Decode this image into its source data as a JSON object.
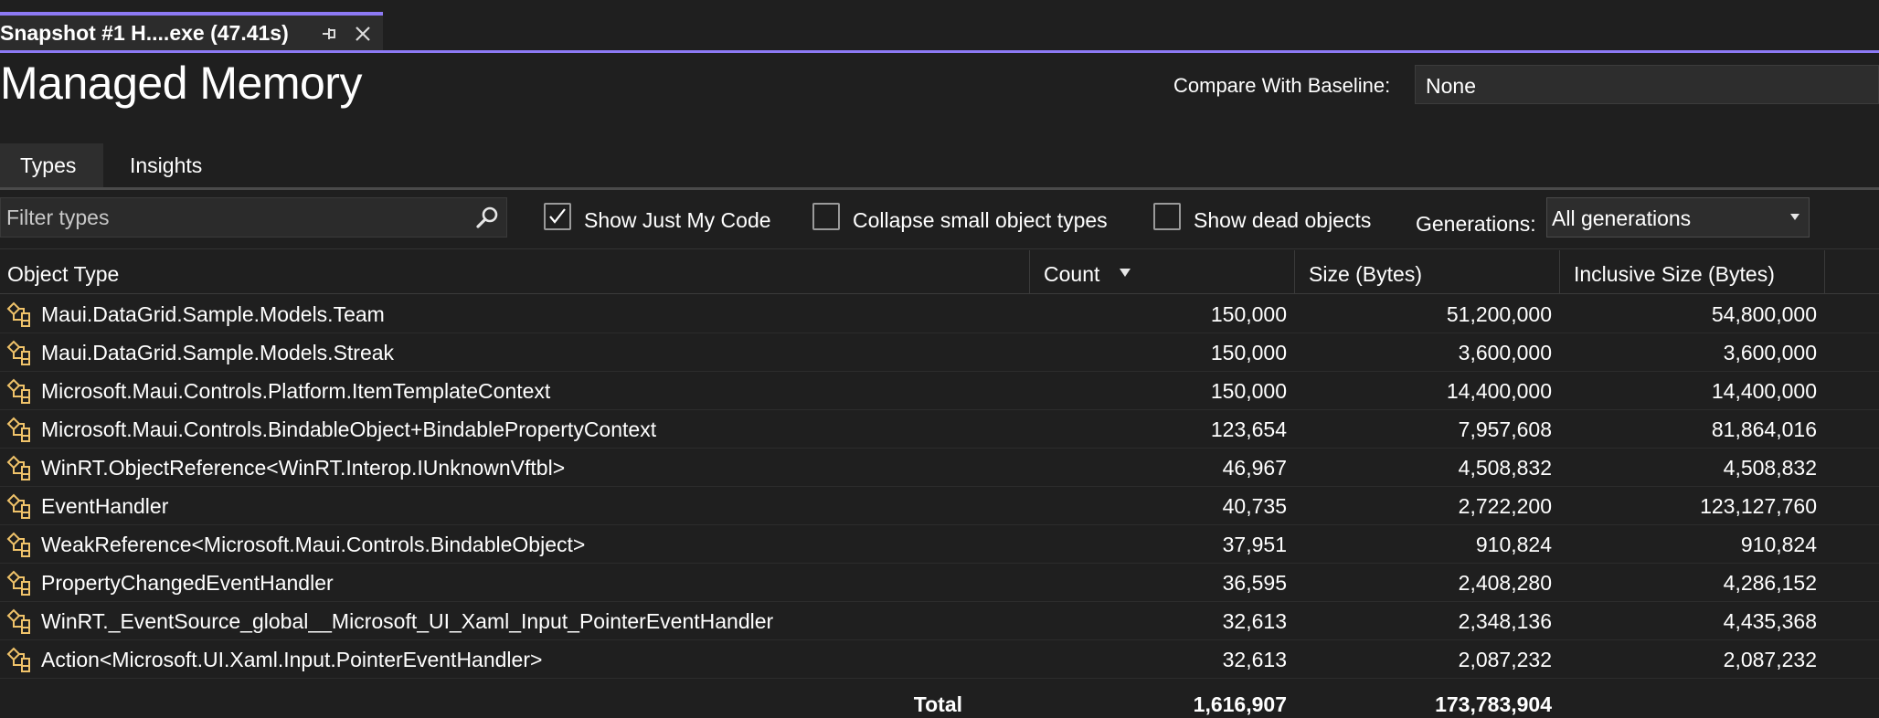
{
  "tab": {
    "title": "Snapshot #1 H....exe (47.41s)"
  },
  "header": {
    "title": "Managed Memory",
    "baseline_label": "Compare With Baseline:",
    "baseline_value": "None"
  },
  "view_tabs": [
    {
      "label": "Types",
      "active": true
    },
    {
      "label": "Insights",
      "active": false
    }
  ],
  "toolbar": {
    "filter_placeholder": "Filter types",
    "show_just_my_code": {
      "label": "Show Just My Code",
      "checked": true
    },
    "collapse_small": {
      "label": "Collapse small object types",
      "checked": false
    },
    "show_dead": {
      "label": "Show dead objects",
      "checked": false
    },
    "generations_label": "Generations:",
    "generations_value": "All generations"
  },
  "columns": {
    "object_type": "Object Type",
    "count": "Count",
    "size": "Size (Bytes)",
    "inclusive_size": "Inclusive Size (Bytes)"
  },
  "rows": [
    {
      "type": "Maui.DataGrid.Sample.Models.Team",
      "count": "150,000",
      "size": "51,200,000",
      "inclusive": "54,800,000"
    },
    {
      "type": "Maui.DataGrid.Sample.Models.Streak",
      "count": "150,000",
      "size": "3,600,000",
      "inclusive": "3,600,000"
    },
    {
      "type": "Microsoft.Maui.Controls.Platform.ItemTemplateContext",
      "count": "150,000",
      "size": "14,400,000",
      "inclusive": "14,400,000"
    },
    {
      "type": "Microsoft.Maui.Controls.BindableObject+BindablePropertyContext",
      "count": "123,654",
      "size": "7,957,608",
      "inclusive": "81,864,016"
    },
    {
      "type": "WinRT.ObjectReference<WinRT.Interop.IUnknownVftbl>",
      "count": "46,967",
      "size": "4,508,832",
      "inclusive": "4,508,832"
    },
    {
      "type": "EventHandler",
      "count": "40,735",
      "size": "2,722,200",
      "inclusive": "123,127,760"
    },
    {
      "type": "WeakReference<Microsoft.Maui.Controls.BindableObject>",
      "count": "37,951",
      "size": "910,824",
      "inclusive": "910,824"
    },
    {
      "type": "PropertyChangedEventHandler",
      "count": "36,595",
      "size": "2,408,280",
      "inclusive": "4,286,152"
    },
    {
      "type": "WinRT._EventSource_global__Microsoft_UI_Xaml_Input_PointerEventHandler",
      "count": "32,613",
      "size": "2,348,136",
      "inclusive": "4,435,368"
    },
    {
      "type": "Action<Microsoft.UI.Xaml.Input.PointerEventHandler>",
      "count": "32,613",
      "size": "2,087,232",
      "inclusive": "2,087,232"
    }
  ],
  "totals": {
    "label": "Total",
    "count": "1,616,907",
    "size": "173,783,904"
  },
  "colors": {
    "accent": "#8d7af5",
    "type_icon": "#f0c36a",
    "background": "#1f1f1f"
  },
  "icons": {
    "type_icon": "class-type-icon",
    "search": "search-icon",
    "pin": "pin-icon",
    "close": "close-icon"
  }
}
